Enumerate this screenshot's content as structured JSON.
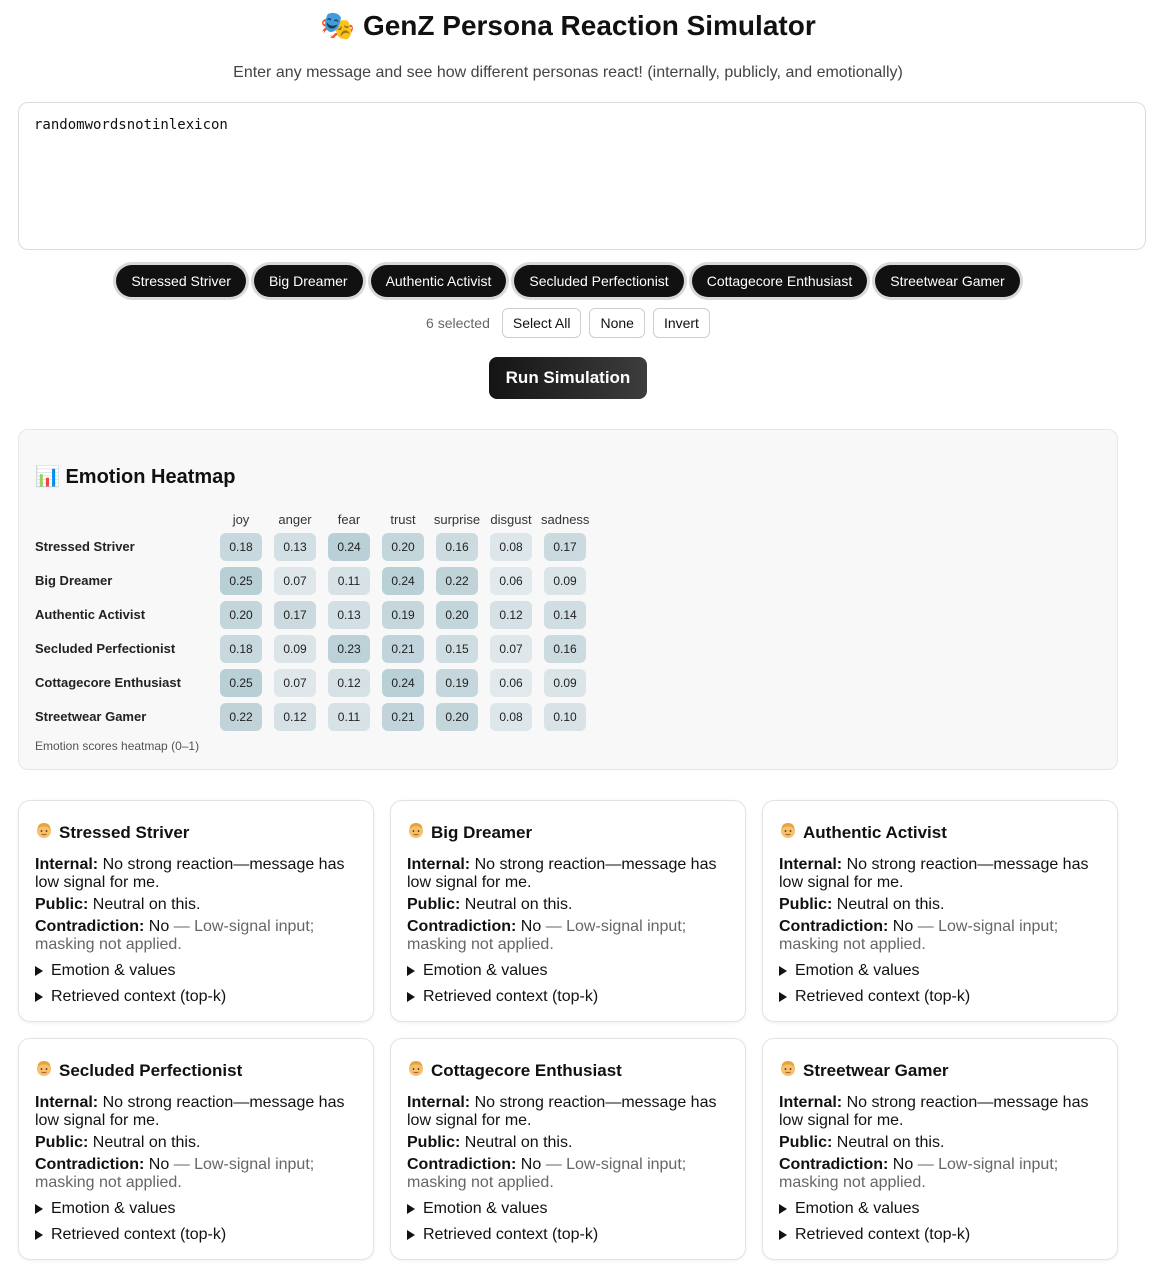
{
  "header": {
    "emoji": "🎭",
    "title": "GenZ Persona Reaction Simulator",
    "subtitle": "Enter any message and see how different personas react! (internally, publicly, and emotionally)"
  },
  "message": {
    "value": "randomwordsnotinlexicon"
  },
  "personas": [
    "Stressed Striver",
    "Big Dreamer",
    "Authentic Activist",
    "Secluded Perfectionist",
    "Cottagecore Enthusiast",
    "Streetwear Gamer"
  ],
  "selection": {
    "count_text": "6 selected",
    "select_all": "Select All",
    "none": "None",
    "invert": "Invert"
  },
  "run_button": "Run Simulation",
  "heatmap": {
    "emoji": "📊",
    "title": "Emotion Heatmap",
    "caption": "Emotion scores heatmap (0–1)",
    "columns": [
      "joy",
      "anger",
      "fear",
      "trust",
      "surprise",
      "disgust",
      "sadness"
    ],
    "rows": [
      {
        "name": "Stressed Striver",
        "values": [
          "0.18",
          "0.13",
          "0.24",
          "0.20",
          "0.16",
          "0.08",
          "0.17"
        ]
      },
      {
        "name": "Big Dreamer",
        "values": [
          "0.25",
          "0.07",
          "0.11",
          "0.24",
          "0.22",
          "0.06",
          "0.09"
        ]
      },
      {
        "name": "Authentic Activist",
        "values": [
          "0.20",
          "0.17",
          "0.13",
          "0.19",
          "0.20",
          "0.12",
          "0.14"
        ]
      },
      {
        "name": "Secluded Perfectionist",
        "values": [
          "0.18",
          "0.09",
          "0.23",
          "0.21",
          "0.15",
          "0.07",
          "0.16"
        ]
      },
      {
        "name": "Cottagecore Enthusiast",
        "values": [
          "0.25",
          "0.07",
          "0.12",
          "0.24",
          "0.19",
          "0.06",
          "0.09"
        ]
      },
      {
        "name": "Streetwear Gamer",
        "values": [
          "0.22",
          "0.12",
          "0.11",
          "0.21",
          "0.20",
          "0.08",
          "0.10"
        ]
      }
    ]
  },
  "labels": {
    "internal": "Internal:",
    "public": "Public:",
    "contradiction": "Contradiction:",
    "emotion_values": "Emotion & values",
    "retrieved_context": "Retrieved context (top-k)"
  },
  "cards": [
    {
      "name": "Stressed Striver",
      "internal": "No strong reaction—message has low signal for me.",
      "public": "Neutral on this.",
      "contradiction": "No",
      "contradiction_note": "— Low-signal input; masking not applied."
    },
    {
      "name": "Big Dreamer",
      "internal": "No strong reaction—message has low signal for me.",
      "public": "Neutral on this.",
      "contradiction": "No",
      "contradiction_note": "— Low-signal input; masking not applied."
    },
    {
      "name": "Authentic Activist",
      "internal": "No strong reaction—message has low signal for me.",
      "public": "Neutral on this.",
      "contradiction": "No",
      "contradiction_note": "— Low-signal input; masking not applied."
    },
    {
      "name": "Secluded Perfectionist",
      "internal": "No strong reaction—message has low signal for me.",
      "public": "Neutral on this.",
      "contradiction": "No",
      "contradiction_note": "— Low-signal input; masking not applied."
    },
    {
      "name": "Cottagecore Enthusiast",
      "internal": "No strong reaction—message has low signal for me.",
      "public": "Neutral on this.",
      "contradiction": "No",
      "contradiction_note": "— Low-signal input; masking not applied."
    },
    {
      "name": "Streetwear Gamer",
      "internal": "No strong reaction—message has low signal for me.",
      "public": "Neutral on this.",
      "contradiction": "No",
      "contradiction_note": "— Low-signal input; masking not applied."
    }
  ]
}
